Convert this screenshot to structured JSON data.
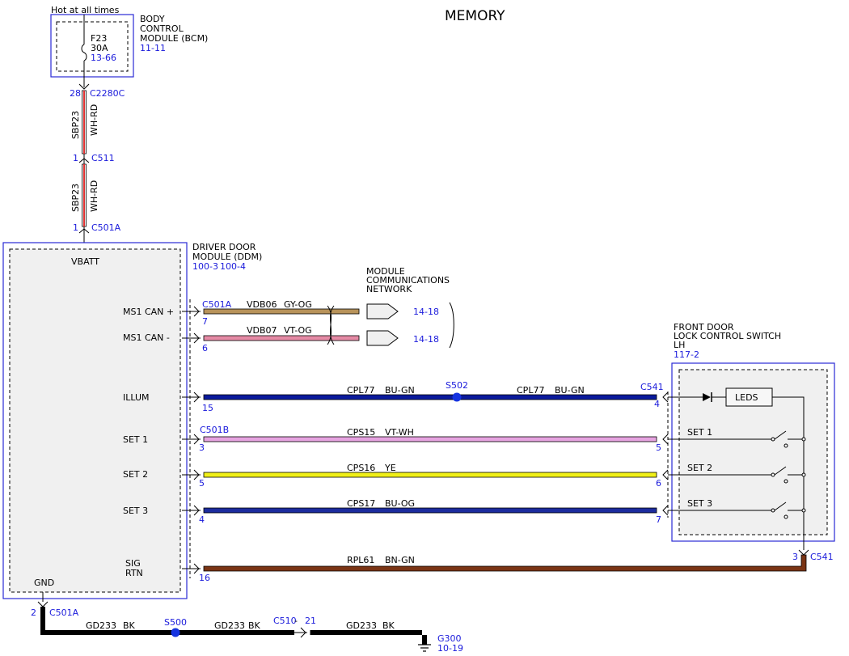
{
  "title": "MEMORY",
  "hot_label": "Hot at all times",
  "bcm": {
    "name": [
      "BODY",
      "CONTROL",
      "MODULE (BCM)"
    ],
    "ref": "11-11",
    "fuse": "F23",
    "fuse_rating": "30A",
    "fuse_ref": "13-66"
  },
  "feed": {
    "connectors": [
      {
        "pin": "28",
        "name": "C2280C"
      },
      {
        "pin": "1",
        "name": "C511"
      },
      {
        "pin": "1",
        "name": "C501A"
      }
    ],
    "circuit": "SBP23",
    "color": "WH-RD"
  },
  "ddm": {
    "name": [
      "DRIVER DOOR",
      "MODULE (DDM)"
    ],
    "ref1": "100-3",
    "ref2": "100-4",
    "pins": [
      "VBATT",
      "MS1 CAN +",
      "MS1 CAN -",
      "ILLUM",
      "SET 1",
      "SET 2",
      "SET 3",
      "SIG",
      "RTN",
      "GND"
    ]
  },
  "network": {
    "name": [
      "MODULE",
      "COMMUNICATIONS",
      "NETWORK"
    ],
    "ref": "14-18"
  },
  "switch": {
    "name": [
      "FRONT DOOR",
      "LOCK CONTROL SWITCH",
      "LH"
    ],
    "ref": "117-2",
    "leds": "LEDS",
    "sets": [
      "SET 1",
      "SET 2",
      "SET 3"
    ]
  },
  "wires": [
    {
      "circuit": "VDB06",
      "color": "GY-OG",
      "fill": "#b8935a",
      "connector": "C501A",
      "pin": "7"
    },
    {
      "circuit": "VDB07",
      "color": "VT-OG",
      "fill": "#e58aa5",
      "pin": "6"
    },
    {
      "circuit": "CPL77",
      "color": "BU-GN",
      "fill": "#0a1a9c",
      "pin": "15",
      "splice": "S502",
      "connector2": "C541",
      "pin2": "4"
    },
    {
      "circuit": "CPS15",
      "color": "VT-WH",
      "fill": "#e6a3e0",
      "connector": "C501B",
      "pin": "3",
      "pin2": "5"
    },
    {
      "circuit": "CPS16",
      "color": "YE",
      "fill": "#f0ef18",
      "pin": "5",
      "pin2": "6"
    },
    {
      "circuit": "CPS17",
      "color": "BU-OG",
      "fill": "#1c2c9e",
      "pin": "4",
      "pin2": "7"
    },
    {
      "circuit": "RPL61",
      "color": "BN-GN",
      "fill": "#7a3414",
      "pin": "16",
      "connector2": "C541",
      "pin2": "3"
    }
  ],
  "ground": {
    "pin": "2",
    "connector": "C501A",
    "circuit": "GD233",
    "color": "BK",
    "splice": "S500",
    "inline": "C510",
    "inline_pin": "21",
    "ground_point": "G300",
    "ground_ref": "10-19"
  },
  "colors": {
    "blue_text": "#1a1adb",
    "box_blue": "#2a2ad6",
    "splice": "#1533e0"
  }
}
